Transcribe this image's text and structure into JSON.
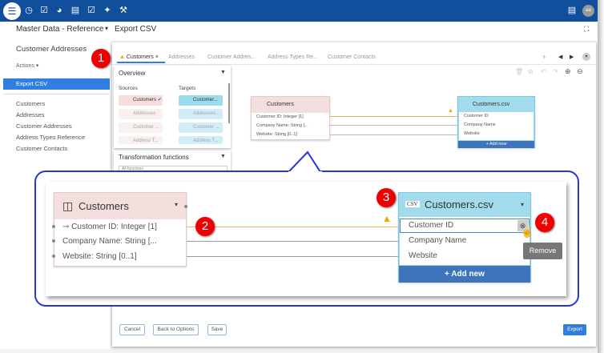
{
  "topbar": {
    "icons": [
      "database-icon",
      "clock-icon",
      "checkbox-icon",
      "gauge-icon",
      "database-list-icon",
      "checklist-icon",
      "plug-icon",
      "wrench-icon"
    ],
    "right_icons": [
      "report-icon"
    ],
    "avatar": "aa",
    "color": "#114f9c"
  },
  "header": {
    "breadcrumb_project": "Master Data - Reference",
    "breadcrumb_page": "Export CSV"
  },
  "sidebar": {
    "title": "Customer Addresses",
    "actions": "Actions",
    "selected": "Export CSV",
    "items": [
      "Customers",
      "Addresses",
      "Customer Addresses",
      "Address Types Reference",
      "Customer Contacts"
    ]
  },
  "tabs": [
    {
      "label": "Customers",
      "active": true,
      "warning": true
    },
    {
      "label": "Addresses"
    },
    {
      "label": "Customer Addres..."
    },
    {
      "label": "Address Types Re..."
    },
    {
      "label": "Customer Contacts"
    }
  ],
  "overview": {
    "title": "Overview",
    "sources_label": "Sources",
    "targets_label": "Targets",
    "sources": [
      "Customers",
      "Addresses",
      "Customer ...",
      "Address T..."
    ],
    "targets": [
      "Customer...",
      "Addresses...",
      "Customer ...",
      "Address T..."
    ]
  },
  "transform": {
    "title": "Transformation functions",
    "select": "All functions"
  },
  "source_node": {
    "title": "Customers",
    "fields": [
      "Customer ID: Integer [1]",
      "Company Name: String [...",
      "Website: String [0..1]"
    ]
  },
  "target_node": {
    "title": "Customers.csv",
    "badge": "CSV",
    "fields": [
      "Customer ID",
      "Company Name",
      "Website"
    ],
    "add_new": "+ Add new"
  },
  "tooltip": "Remove",
  "callouts": [
    "1",
    "2",
    "3",
    "4"
  ],
  "footer": {
    "cancel": "Cancel",
    "back": "Back to Options",
    "save": "Save",
    "export": "Export"
  },
  "colors": {
    "accent": "#2f7ee0",
    "callout": "#e00000",
    "warning": "#f0a500"
  }
}
